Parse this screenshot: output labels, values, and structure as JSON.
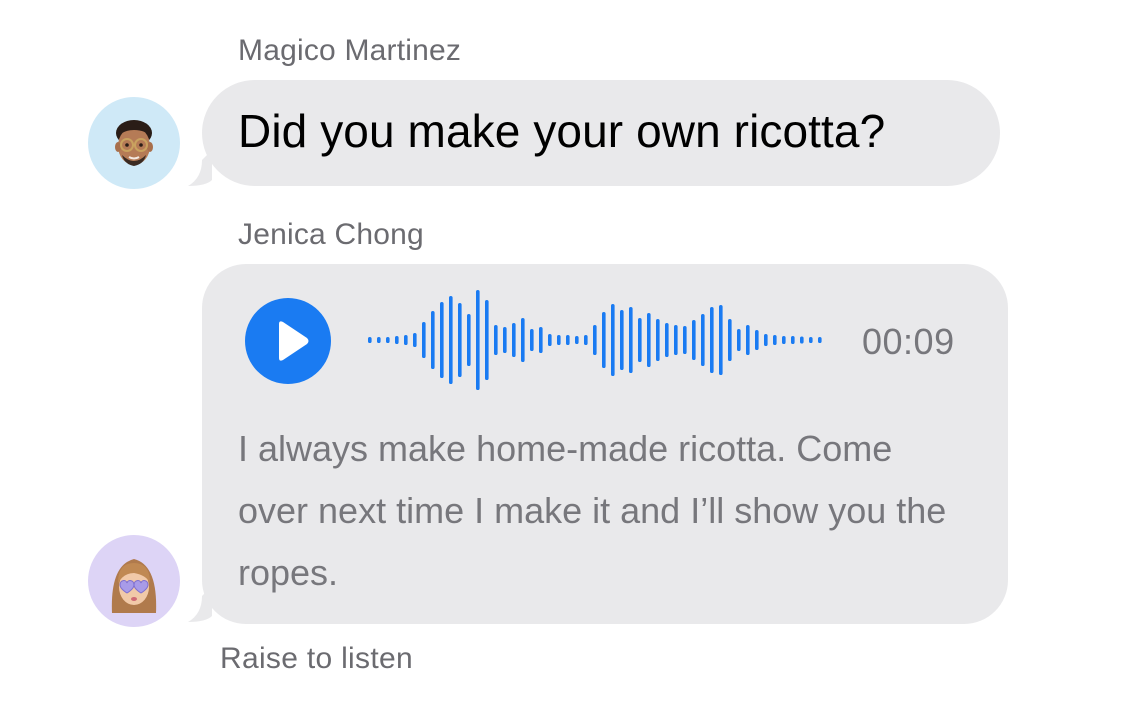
{
  "messages": [
    {
      "sender": "Magico Martinez",
      "avatar_icon": "memoji-man-with-glasses-icon",
      "text": "Did you make your own ricotta?"
    },
    {
      "sender": "Jenica Chong",
      "avatar_icon": "memoji-woman-with-heart-sunglasses-icon",
      "audio": {
        "play_icon": "play-icon",
        "duration": "00:09"
      },
      "transcript": "I always make home-made ricotta. Come over next time I make it and I’ll show you the ropes."
    }
  ],
  "footer": {
    "raise_to_listen": "Raise to listen"
  },
  "colors": {
    "accent": "#1a7bf2",
    "bubble": "#e9e9eb",
    "secondary_text": "#77777c"
  }
}
